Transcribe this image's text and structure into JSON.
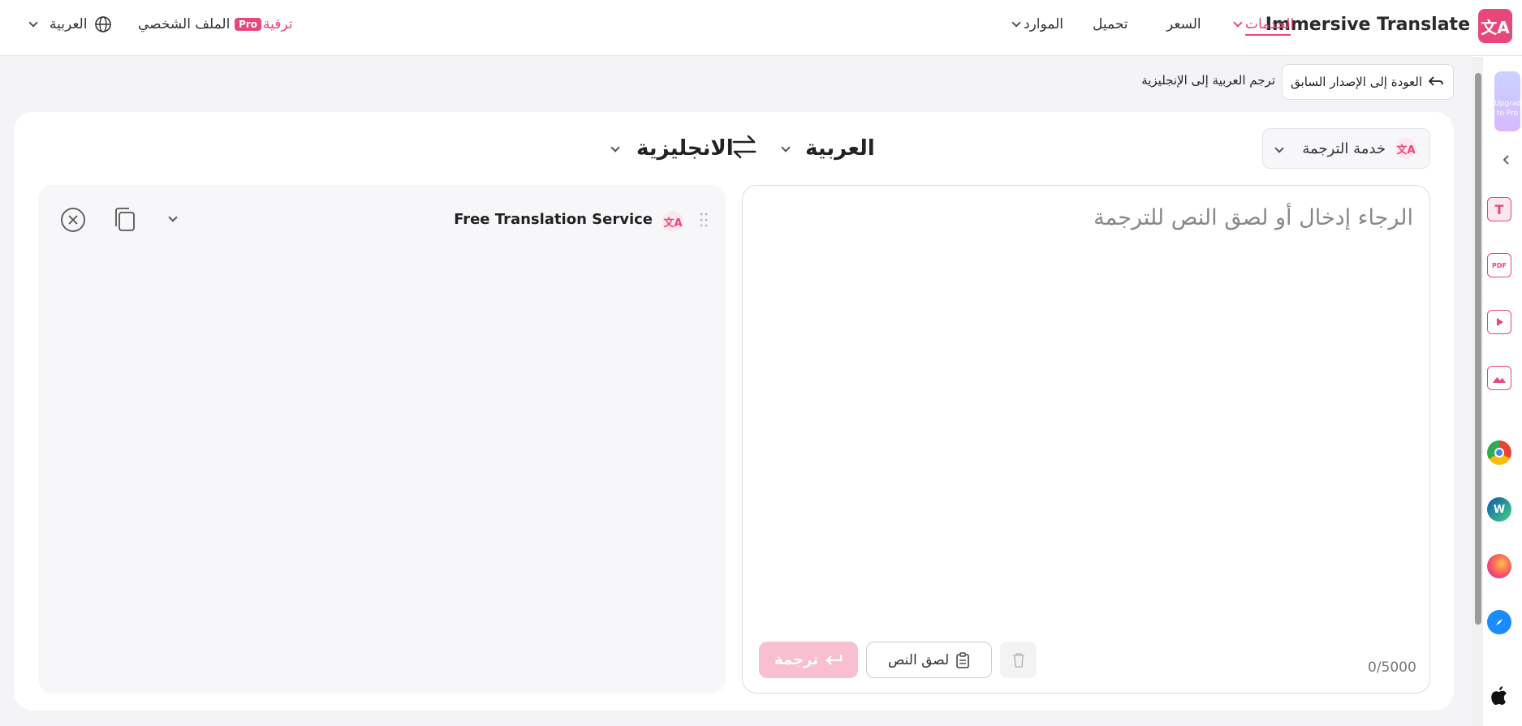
{
  "header": {
    "brand_name": "Immersive Translate",
    "nav": {
      "services": "الخدمات",
      "price": "السعر",
      "download": "تحميل",
      "resources": "الموارد"
    },
    "pro_badge": "Pro",
    "upgrade": "ترقية",
    "profile": "الملف الشخصي",
    "language": "العربية",
    "accent_color": "#e9467a"
  },
  "subbar": {
    "back_button": "العودة إلى الإصدار السابق",
    "breadcrumb": "ترجم العربية إلى الإنجليزية"
  },
  "translator": {
    "service_select": "خدمة الترجمة",
    "source_lang": "العربية",
    "target_lang": "الانجليزية",
    "source": {
      "placeholder": "الرجاء إدخال أو لصق النص للترجمة",
      "counter": "0/5000",
      "paste_button": "لصق النص",
      "translate_button": "ترجمة"
    },
    "target": {
      "service_name": "Free Translation Service"
    }
  },
  "sidebar": {
    "upgrade_tab": "Upgrade to Pro"
  }
}
